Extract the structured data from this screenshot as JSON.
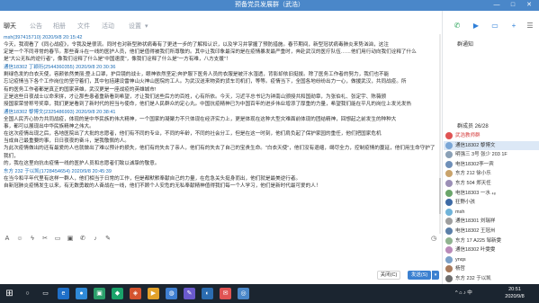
{
  "window": {
    "title": "预备党员发展群（武浩）",
    "controls": [
      "—",
      "□",
      "✕"
    ]
  },
  "tabs": [
    "聊天",
    "公告",
    "相册",
    "文件",
    "活动",
    "设置"
  ],
  "messages": [
    {
      "sender": "msh(397415710)",
      "time": "2020/9/8 20:15:42",
      "paragraphs": [
        "今天，我观看了《同心战疫》，令我及是很流。同时也对新型肺状病毒有了更进一步的了解和认识，以及学习并掌握了预防措施。春节期间，新型冠状病毒肺炎来势汹汹，这注",
        "定是一个不同寻常的春节。那些奋斗在一线的医护人员，他们是值得被我们所尊敬的。其中让我印象最深的是在疫情暴发最严重时，奔赴武汉的医疗队伍……他们用行动向我们诠释了什么",
        "是\"大公无私的逆行者\"，像我们诠释了什么是\"中国速度\"，像我们诠释了什么是\"一方有难，八方支援\"！"
      ]
    },
    {
      "sender": "通信18302 丁颖珩(2544360355)",
      "time": "2020/9/8 20:30:36",
      "paragraphs": [
        "剩绿色发的白衣天使，容颜依然美丽;登上口罩，护目镜的战士，眼神依然坚定;奔护服下医务人员的衣服是被汗水湿透，背影却依旧挺拔。除了医务工作者的努力，我们也不能",
        "忘记疫情当下各个工作岗位的坚守着们，其中包括建设雷神山火神山医院的工人。为武汉送来物资的货车司机们，等等。疫情当下，全国各地纷纷出力一心，做援武汉，共同战疫。所",
        "有的医务工作者都是真正的国家英雄，武汉更是一座战疫的英雄城市!",
        "正是这些日夜战士以命来拼，才让那些患者重新看到希望，才让我们这些后方的百姓，心有所依。今天，习近平总书记为钟南山颁授共和国勋章，为张伯礼、张定宇、陈薇颁",
        "授国家荣誉称号奖章，我们更是看到了新时代的担当与使命，他们是人民群众的定心丸。中国抗疫精神已为中国百年的进步伟业增添了厚重的力量，希望我们能在平凡的岗位上发光发热"
      ]
    },
    {
      "sender": "通信18302 黎博文(2325486993)",
      "time": "2020/9/8 20:38:41",
      "paragraphs": [
        "全国人民齐心协力共同战疫，体现的是中华民族的伟大精神，一个国家的凝聚力不只体现在经济实力上，更是体现在这种大型灾难面前体现的团结精神，回想起之前发生的种种大",
        "事，都可以展现出中华民族精神之伟大。",
        "在这次疫情出现之后，各地医院出了大批的志愿者，他们有不同的专业，不同的年龄，不同的社会分工，但是在这一时刻，他们肩负起了保护家园的重任，他们把国家危机",
        "当成自己最重要的事，日日夜夜的奋斗，是我敬佩的人。",
        "为此次疫情做出的还有最爱的人也就做出了难以预计的损失，他们有的失去了亲人，他们有的失去了自己的宝贵生命。\"白衣天使\"，他们没有退缩，竭尽全力，控制疫情的蔓延，他们用生命守护了我们，",
        "的，我在这里向抗击疫情一线的医护人员和志愿者们致以诚挚的敬意。"
      ]
    },
    {
      "sender": "东方 232 于以凯(1728454654)",
      "time": "2020/9/8 20:45:39",
      "paragraphs": [
        "在当今和平年代里有这样一群人，他们相当于日常的工作，但是都默默奉献自己的力量，在危急关头挺身而出，他们就是最美逆行者。",
        "自新冠肺炎疫情发生以来，有无数勇敢的人奋战在一线，他们不顾个人安危的无私奉献精神值得我们每一个人学习，他们是新时代最可爱的人！"
      ]
    }
  ],
  "input_toolbar_icons": [
    "font-icon",
    "emoji-icon",
    "lightning-icon",
    "scissors-icon",
    "folder-icon",
    "image-icon",
    "phone-icon",
    "mic-icon",
    "pen-icon",
    "history-icon"
  ],
  "input": {
    "close_label": "关闭(C)",
    "send_label": "发送(S)",
    "send_arrow": "▾"
  },
  "sidebar": {
    "notice_title": "群通知",
    "members_title": "群成员 26/28",
    "members": [
      {
        "name": "武浩教师群",
        "color": "#e05353",
        "self": true
      },
      {
        "name": "通信18302 黎博文",
        "color": "#7aa6d6",
        "sel": true
      },
      {
        "name": "明强三 3号 张少 203 1F",
        "color": "#8aa0b6"
      },
      {
        "name": "电信18302李一宾",
        "color": "#6e8fb8"
      },
      {
        "name": "东方 212 徐小乐",
        "color": "#c9a36b"
      },
      {
        "name": "东方 504 郑天任",
        "color": "#9b8fb6"
      },
      {
        "name": "电信18303 一水 ₄₈",
        "color": "#6aa56a"
      },
      {
        "name": "狂野小孩",
        "color": "#3d6aa5"
      },
      {
        "name": "msh",
        "color": "#6fb3d9"
      },
      {
        "name": "通信18301 刘瑞祥",
        "color": "#9e9e9e"
      },
      {
        "name": "电信18302 王冠州",
        "color": "#5b7fa8"
      },
      {
        "name": "东方 17 A225 邹新雯",
        "color": "#8fb38f"
      },
      {
        "name": "通信18302 叶雯雯",
        "color": "#b98ab9"
      },
      {
        "name": "ynqs",
        "color": "#7aa0c8"
      },
      {
        "name": "杨哲",
        "color": "#a87a5c"
      },
      {
        "name": "东方 232 于以凯",
        "color": "#6e6e6e"
      }
    ]
  },
  "taskbar": {
    "start": "⊞",
    "apps": [
      "○",
      "▭",
      "e",
      "●",
      "▣",
      "◆",
      "◈",
      "▶",
      "◍",
      "✎",
      "◐",
      "✉",
      "◎"
    ],
    "tray_text": "^ ⌂ ♪ 中",
    "time": "20:51",
    "date": "2020/9/8"
  },
  "colors": {
    "accent": "#4a87c9",
    "link": "#1d6db5",
    "taskbar": "#1b2530"
  }
}
